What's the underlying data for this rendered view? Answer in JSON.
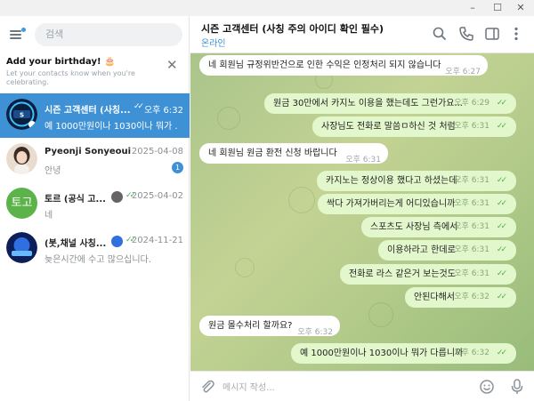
{
  "window": {
    "min": "–",
    "max": "☐",
    "close": "✕"
  },
  "sidebar": {
    "search_placeholder": "검색",
    "birthday": {
      "title": "Add your birthday!",
      "emoji": "🎂",
      "subtitle": "Let your contacts know when you're celebrating."
    },
    "chats": [
      {
        "name": "시즌 고객센터 (사칭...",
        "time": "오후 6:32",
        "last": "예 1000만원이나 1030이나 뭐가 ...",
        "checks": "✓✓",
        "active": true
      },
      {
        "name": "Pyeonji Sonyeoui",
        "time": "2025-04-08",
        "last": "안녕",
        "unread": "1"
      },
      {
        "name": "토르 (공식 고...",
        "avatar_text": "토고",
        "time": "2025-04-02",
        "last": "네",
        "checks": "✓✓"
      },
      {
        "name": "(봇,채널 사칭...",
        "time": "2024-11-21",
        "last": "늦은시간에 수고 많으십니다.",
        "checks": "✓✓"
      }
    ]
  },
  "header": {
    "title": "시즌 고객센터 (사칭 주의 아이디 확인 필수)",
    "status": "온라인"
  },
  "messages": [
    {
      "dir": "in",
      "text": "네 회원님 규정위반건으로 인한 수익은 인정처리 되지 않습니다",
      "time": "오후 6:27"
    },
    {
      "dir": "out",
      "text": "원금 30만에서 카지노 이용을 했는데도 그런가요...",
      "time": "오후 6:29",
      "checks": "✓✓"
    },
    {
      "dir": "out",
      "text": "사장님도 전화로 말씀ㅁ하신 것 처럼",
      "time": "오후 6:31",
      "checks": "✓✓"
    },
    {
      "dir": "in",
      "text": "네 회원님 원금 환전 신청 바랍니다",
      "time": "오후 6:31"
    },
    {
      "dir": "out",
      "text": "카지노는 정상이용 했다고 하셨는데",
      "time": "오후 6:31",
      "checks": "✓✓"
    },
    {
      "dir": "out",
      "text": "싹다 가져가버리는게 어디있습니까",
      "time": "오후 6:31",
      "checks": "✓✓"
    },
    {
      "dir": "out",
      "text": "스포츠도 사장님 측에서",
      "time": "오후 6:31",
      "checks": "✓✓"
    },
    {
      "dir": "out",
      "text": "이용하라고 한데로",
      "time": "오후 6:31",
      "checks": "✓✓"
    },
    {
      "dir": "out",
      "text": "전화로 라스 같은거 보는것도",
      "time": "오후 6:31",
      "checks": "✓✓"
    },
    {
      "dir": "out",
      "text": "안된다해서",
      "time": "오후 6:32",
      "checks": "✓✓"
    },
    {
      "dir": "in",
      "text": "원금 몰수처리 할까요?",
      "time": "오후 6:32"
    },
    {
      "dir": "out",
      "text": "예 1000만원이나 1030이나 뭐가 다릅니까",
      "time": "오후 6:32",
      "checks": "✓✓"
    }
  ],
  "composer": {
    "placeholder": "메시지 작성..."
  },
  "colors": {
    "accent": "#3f91d6",
    "out_bubble": "#e2f7cb",
    "check": "#4fae4e"
  }
}
